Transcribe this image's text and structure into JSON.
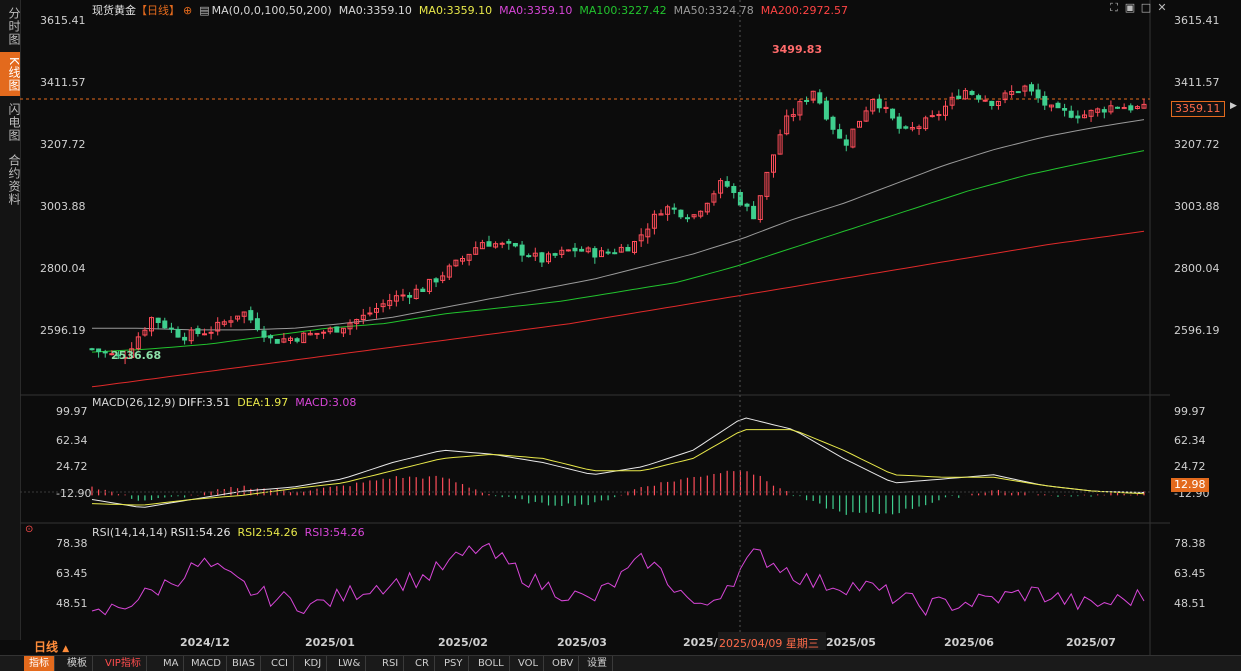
{
  "left_tabs": [
    "分时图",
    "K线图",
    "闪电图",
    "合约资料"
  ],
  "main_legend": {
    "instrument": "现货黄金",
    "period": "【日线】",
    "ma_params": "MA(0,0,0,100,50,200)",
    "ma0_a": "MA0:3359.10",
    "ma0_b": "MA0:3359.10",
    "ma0_c": "MA0:3359.10",
    "ma100": "MA100:3227.42",
    "ma50": "MA50:3324.78",
    "ma200": "MA200:2972.57"
  },
  "macd_legend": {
    "label": "MACD(26,12,9)",
    "diff": "DIFF:3.51",
    "dea": "DEA:1.97",
    "macd": "MACD:3.08"
  },
  "rsi_legend": {
    "label": "RSI(14,14,14)",
    "rsi1": "RSI1:54.26",
    "rsi2": "RSI2:54.26",
    "rsi3": "RSI3:54.26"
  },
  "price_axis": [
    "3615.41",
    "3411.57",
    "3207.72",
    "3003.88",
    "2800.04",
    "2596.19"
  ],
  "macd_axis": [
    "99.97",
    "62.34",
    "24.72",
    "-12.90"
  ],
  "rsi_axis": [
    "78.38",
    "63.45",
    "48.51"
  ],
  "x_axis": [
    "2024/12",
    "2025/01",
    "2025/02",
    "2025/03",
    "2025/",
    "2025/05",
    "2025/06",
    "2025/07"
  ],
  "crosshair_date": "2025/04/09 星期三",
  "high_label": "3499.83",
  "low_label": "2536.68",
  "current_price": "3359.11",
  "macd_current": "12.98",
  "period_selector": "日线",
  "toolbar": [
    "指标",
    "模板",
    "VIP指标",
    "MA",
    "MACD",
    "BIAS",
    "CCI",
    "KDJ",
    "LW&",
    "RSI",
    "CR",
    "PSY",
    "BOLL",
    "VOL",
    "OBV",
    "设置"
  ],
  "colors": {
    "up": "#ff4d5a",
    "down": "#3fcf8e",
    "ma50": "#9a9a9a",
    "ma100": "#22c32e",
    "ma200": "#e02a2a",
    "macd_dea": "#e8e84a",
    "macd_diff": "#e8e8e8",
    "rsi": "#d846d8",
    "accent": "#e36a1d"
  },
  "chart_data": {
    "type": "candlestick",
    "title": "现货黄金【日线】",
    "ylim": [
      2470,
      3640
    ],
    "highest": 3499.83,
    "lowest": 2536.68,
    "close_keypoints": [
      2600,
      2570,
      2700,
      2640,
      2660,
      2720,
      2625,
      2640,
      2660,
      2700,
      2760,
      2790,
      2860,
      2940,
      2920,
      2880,
      2915,
      2900,
      2930,
      3050,
      3020,
      3130,
      3020,
      3310,
      3420,
      3240,
      3400,
      3280,
      3330,
      3420,
      3380,
      3430,
      3350,
      3340,
      3370,
      3359
    ],
    "ma50_keypoints": [
      2665,
      2665,
      2660,
      2660,
      2665,
      2680,
      2700,
      2730,
      2760,
      2790,
      2820,
      2860,
      2900,
      2950,
      3010,
      3060,
      3120,
      3180,
      3230,
      3270,
      3300,
      3325
    ],
    "ma100_keypoints": [
      2590,
      2600,
      2615,
      2640,
      2665,
      2680,
      2710,
      2730,
      2750,
      2780,
      2810,
      2860,
      2920,
      2980,
      3040,
      3100,
      3150,
      3190,
      3227
    ],
    "ma200_keypoints": [
      2480,
      2520,
      2560,
      2600,
      2640,
      2680,
      2730,
      2780,
      2830,
      2880,
      2930,
      2972
    ],
    "macd_diff_keypoints": [
      -5,
      -15,
      -5,
      5,
      10,
      20,
      40,
      55,
      50,
      40,
      25,
      35,
      55,
      95,
      80,
      45,
      15,
      20,
      25,
      12,
      5,
      3.51
    ],
    "macd_dea_keypoints": [
      -10,
      -12,
      -5,
      0,
      8,
      15,
      30,
      45,
      50,
      45,
      30,
      30,
      45,
      80,
      80,
      55,
      25,
      22,
      22,
      12,
      5,
      1.97
    ],
    "macd_ylim": [
      -30,
      110
    ],
    "rsi_keypoints": [
      45,
      55,
      68,
      55,
      50,
      58,
      62,
      75,
      60,
      52,
      70,
      48,
      72,
      60,
      58,
      50,
      52,
      56,
      50,
      54.26
    ],
    "rsi_ylim": [
      40,
      82
    ]
  }
}
